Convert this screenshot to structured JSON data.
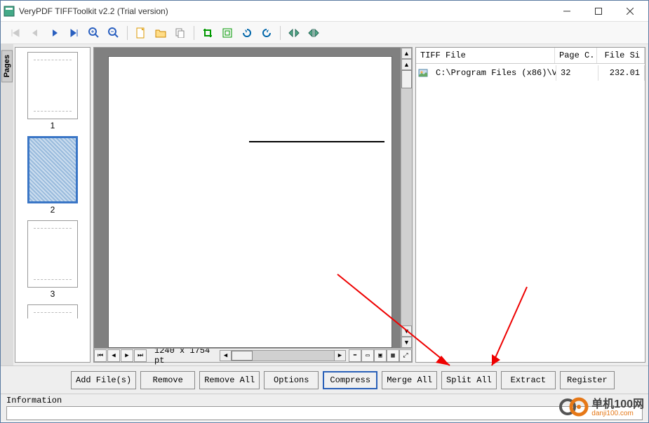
{
  "window": {
    "title": "VeryPDF TIFFToolkit v2.2 (Trial version)"
  },
  "thumbs": {
    "items": [
      {
        "label": "1",
        "selected": false
      },
      {
        "label": "2",
        "selected": true
      },
      {
        "label": "3",
        "selected": false
      }
    ],
    "tab_label": "Pages"
  },
  "viewer": {
    "dimensions": "1240 x 1754 pt"
  },
  "filelist": {
    "headers": {
      "file": "TIFF File",
      "pages": "Page C...",
      "size": "File Si"
    },
    "rows": [
      {
        "path": "C:\\Program Files (x86)\\Ver...",
        "pages": "32",
        "size": "232.01"
      }
    ]
  },
  "buttons": {
    "add": "Add File(s)",
    "remove": "Remove",
    "remove_all": "Remove All",
    "options": "Options",
    "compress": "Compress",
    "merge": "Merge All",
    "split": "Split All",
    "extract": "Extract",
    "register": "Register"
  },
  "info": {
    "label": "Information"
  },
  "branding": {
    "cn": "单机100网",
    "en": "danji100.com"
  }
}
